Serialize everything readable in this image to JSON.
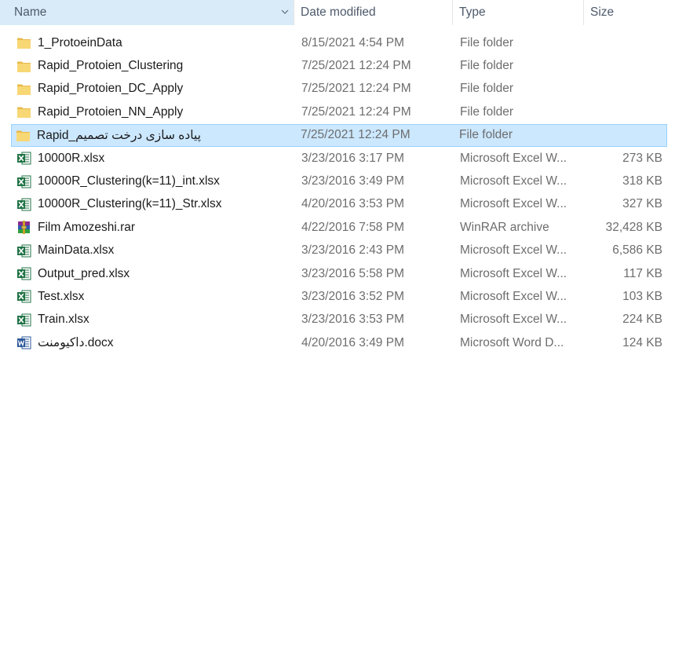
{
  "columns": {
    "name": "Name",
    "date": "Date modified",
    "type": "Type",
    "size": "Size"
  },
  "files": [
    {
      "name": "1_ProtoeinData",
      "date": "8/15/2021 4:54 PM",
      "type": "File folder",
      "size": "",
      "icon": "folder-icon"
    },
    {
      "name": "Rapid_Protoien_Clustering",
      "date": "7/25/2021 12:24 PM",
      "type": "File folder",
      "size": "",
      "icon": "folder-icon"
    },
    {
      "name": "Rapid_Protoien_DC_Apply",
      "date": "7/25/2021 12:24 PM",
      "type": "File folder",
      "size": "",
      "icon": "folder-icon"
    },
    {
      "name": "Rapid_Protoien_NN_Apply",
      "date": "7/25/2021 12:24 PM",
      "type": "File folder",
      "size": "",
      "icon": "folder-icon"
    },
    {
      "name": "Rapid_پیاده سازی درخت تصمیم",
      "date": "7/25/2021 12:24 PM",
      "type": "File folder",
      "size": "",
      "icon": "folder-icon",
      "selected": true
    },
    {
      "name": "10000R.xlsx",
      "date": "3/23/2016 3:17 PM",
      "type": "Microsoft Excel W...",
      "size": "273 KB",
      "icon": "excel-icon"
    },
    {
      "name": "10000R_Clustering(k=11)_int.xlsx",
      "date": "3/23/2016 3:49 PM",
      "type": "Microsoft Excel W...",
      "size": "318 KB",
      "icon": "excel-icon"
    },
    {
      "name": "10000R_Clustering(k=11)_Str.xlsx",
      "date": "4/20/2016 3:53 PM",
      "type": "Microsoft Excel W...",
      "size": "327 KB",
      "icon": "excel-icon"
    },
    {
      "name": "Film Amozeshi.rar",
      "date": "4/22/2016 7:58 PM",
      "type": "WinRAR archive",
      "size": "32,428 KB",
      "icon": "winrar-icon"
    },
    {
      "name": "MainData.xlsx",
      "date": "3/23/2016 2:43 PM",
      "type": "Microsoft Excel W...",
      "size": "6,586 KB",
      "icon": "excel-icon"
    },
    {
      "name": "Output_pred.xlsx",
      "date": "3/23/2016 5:58 PM",
      "type": "Microsoft Excel W...",
      "size": "117 KB",
      "icon": "excel-icon"
    },
    {
      "name": "Test.xlsx",
      "date": "3/23/2016 3:52 PM",
      "type": "Microsoft Excel W...",
      "size": "103 KB",
      "icon": "excel-icon"
    },
    {
      "name": "Train.xlsx",
      "date": "3/23/2016 3:53 PM",
      "type": "Microsoft Excel W...",
      "size": "224 KB",
      "icon": "excel-icon"
    },
    {
      "name": "داکیومنت.docx",
      "date": "4/20/2016 3:49 PM",
      "type": "Microsoft Word D...",
      "size": "124 KB",
      "icon": "word-icon"
    }
  ],
  "colors": {
    "header_active": "#d9ebf9",
    "selection_bg": "#cce8ff",
    "selection_border": "#99d1ff",
    "folder": "#f8d775",
    "excel": "#1f7244",
    "word": "#2b579a"
  }
}
